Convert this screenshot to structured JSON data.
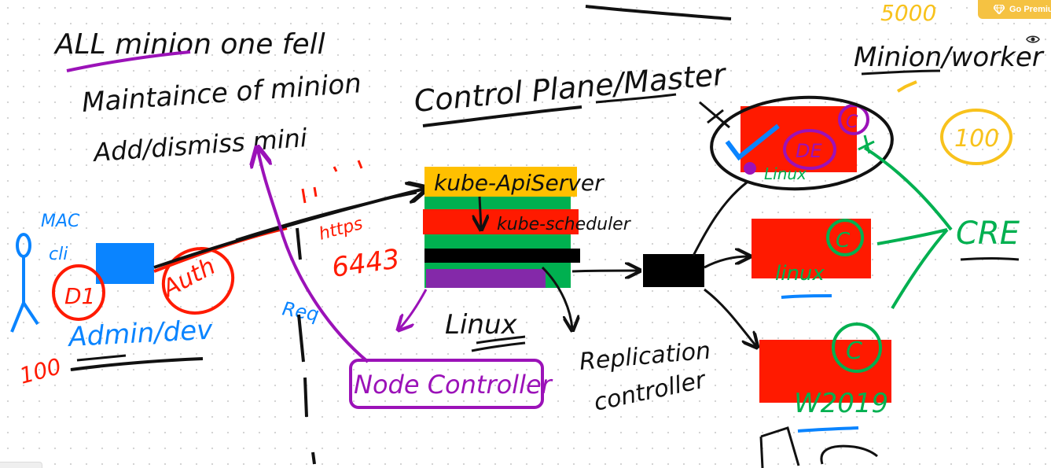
{
  "toolbar": {
    "premium_label": "Go Premium"
  },
  "notes": {
    "all_minion": "ALL minion one fell",
    "maintenance": "Maintaince of minion",
    "add_dismiss": "Add/dismiss mini",
    "control_plane": "Control Plane/Master",
    "minion_worker": "Minion/worker",
    "count_5000": "5000",
    "count_100": "100",
    "cri": "CRE"
  },
  "left": {
    "mac": "MAC",
    "cli": "cli",
    "d1": "D1",
    "auth": "Auth",
    "admin": "Admin/dev",
    "count_100": "100",
    "https": "https",
    "port": "6443",
    "req": "Req"
  },
  "stack": {
    "apiserver": "kube-ApiServer",
    "scheduler": "kube-scheduler",
    "linux": "Linux",
    "node_controller": "Node Controller",
    "replication_1": "Replication",
    "replication_2": "controller"
  },
  "nodes": [
    {
      "label": "Linux",
      "badge": "C",
      "mark": "DE"
    },
    {
      "label": "linux",
      "badge": "C"
    },
    {
      "label": "W2019",
      "badge": "C"
    }
  ],
  "colors": {
    "red": "#ff1a00",
    "orange": "#ffc000",
    "green": "#00b050",
    "blue": "#0a84ff",
    "purple": "#9b12b8",
    "yellow": "#f8c21c",
    "ink": "#111111"
  }
}
